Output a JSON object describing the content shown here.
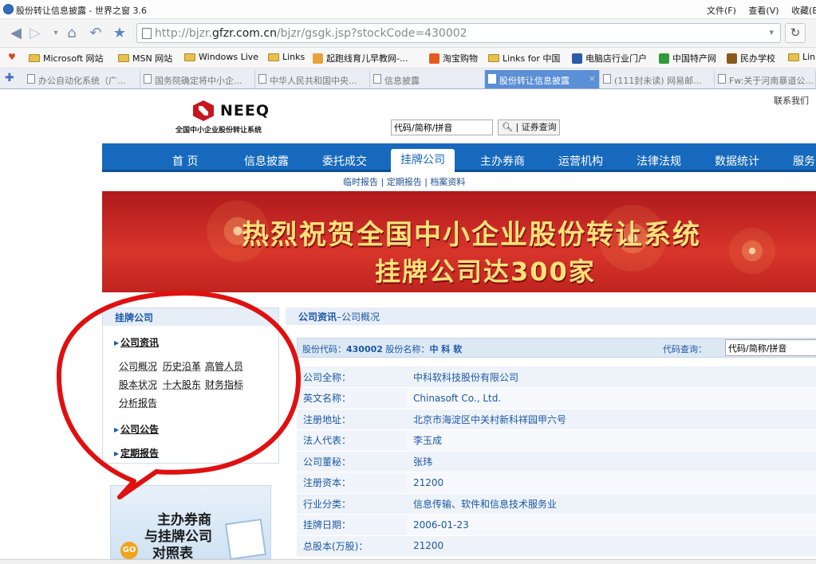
{
  "browser": {
    "window_title": "股份转让信息披露 - 世界之窗 3.6",
    "menus": [
      "文件(F)",
      "查看(V)",
      "收藏(B"
    ],
    "url_prefix": "http://bjzr.",
    "url_domain": "gfzr.com.cn",
    "url_path": "/bjzr/gsgk.jsp?stockCode=430002",
    "favorites": [
      {
        "label": "Microsoft 网站",
        "icon": "folder-icon"
      },
      {
        "label": "MSN 网站",
        "icon": "folder-icon"
      },
      {
        "label": "Windows Live",
        "icon": "folder-icon"
      },
      {
        "label": "Links",
        "icon": "folder-icon"
      },
      {
        "label": "起跑线育儿早教网-...",
        "icon": "site-icon",
        "color": "#e8a23a"
      },
      {
        "label": "淘宝购物",
        "icon": "site-icon",
        "color": "#e65a1e"
      },
      {
        "label": "Links for 中国",
        "icon": "folder-icon"
      },
      {
        "label": "电脑店行业门户",
        "icon": "site-icon",
        "color": "#2a5ca8"
      },
      {
        "label": "中国特产网",
        "icon": "site-icon",
        "color": "#2f9a3a"
      },
      {
        "label": "民办学校",
        "icon": "site-icon",
        "color": "#8a5a1a"
      },
      {
        "label": "Lin",
        "icon": "folder-icon"
      }
    ],
    "tabs": [
      {
        "label": "办公自动化系统（广...",
        "active": false
      },
      {
        "label": "国务院确定将中小企...",
        "active": false
      },
      {
        "label": "中华人民共和国中央...",
        "active": false
      },
      {
        "label": "信息披露",
        "active": false
      },
      {
        "label": "股份转让信息披露",
        "active": true
      },
      {
        "label": "(111封未读) 网易邮...",
        "active": false
      },
      {
        "label": "Fw:关于河南暴道公...",
        "active": false
      }
    ]
  },
  "site": {
    "contact": "联系我们",
    "logo_name": "NEEQ",
    "logo_subtitle": "全国中小企业股份转让系统",
    "search_placeholder": "代码/简称/拼音",
    "search_button": "证券查询",
    "nav": [
      "首 页",
      "信息披露",
      "委托成交",
      "挂牌公司",
      "主办券商",
      "运营机构",
      "法律法规",
      "数据统计",
      "服务"
    ],
    "nav_active": "挂牌公司",
    "subnav": "临时报告 | 定期报告 | 档案资料",
    "banner_line1": "热烈祝贺全国中小企业股份转让系统",
    "banner_line2": "挂牌公司达300家"
  },
  "sidebar": {
    "header": "挂牌公司",
    "section1": "公司资讯",
    "links": [
      "公司概况",
      "历史沿革",
      "高管人员",
      "股本状况",
      "十大股东",
      "财务指标",
      "分析报告"
    ],
    "section2": "公司公告",
    "section3": "定期报告",
    "promo": [
      "主办券商",
      "与挂牌公司",
      "对照表"
    ],
    "promo_badge": "GO"
  },
  "main": {
    "header": "公司资讯",
    "header_sub": "–公司概况",
    "code_label": "股份代码：",
    "code": "430002",
    "name_label": " 股份名称：",
    "name": "中 科 软",
    "query_label": "代码查询：",
    "query_placeholder": "代码/简称/拼音",
    "rows": [
      {
        "k": "公司全称：",
        "v": "中科软科技股份有限公司"
      },
      {
        "k": "英文名称：",
        "v": "Chinasoft Co., Ltd."
      },
      {
        "k": "注册地址：",
        "v": "北京市海淀区中关村新科祥园甲六号"
      },
      {
        "k": "法人代表：",
        "v": "李玉成"
      },
      {
        "k": "公司董秘：",
        "v": "张玮"
      },
      {
        "k": "注册资本：",
        "v": "21200"
      },
      {
        "k": "行业分类：",
        "v": "信息传输、软件和信息技术服务业"
      },
      {
        "k": "挂牌日期：",
        "v": "2006-01-23"
      },
      {
        "k": "总股本(万股)：",
        "v": "21200"
      }
    ]
  },
  "colors": {
    "nav_blue": "#1669bd",
    "banner_red": "#c8231e",
    "banner_text": "#ffe27a",
    "annotation_red": "#e01010",
    "link_blue": "#1b57a5"
  }
}
